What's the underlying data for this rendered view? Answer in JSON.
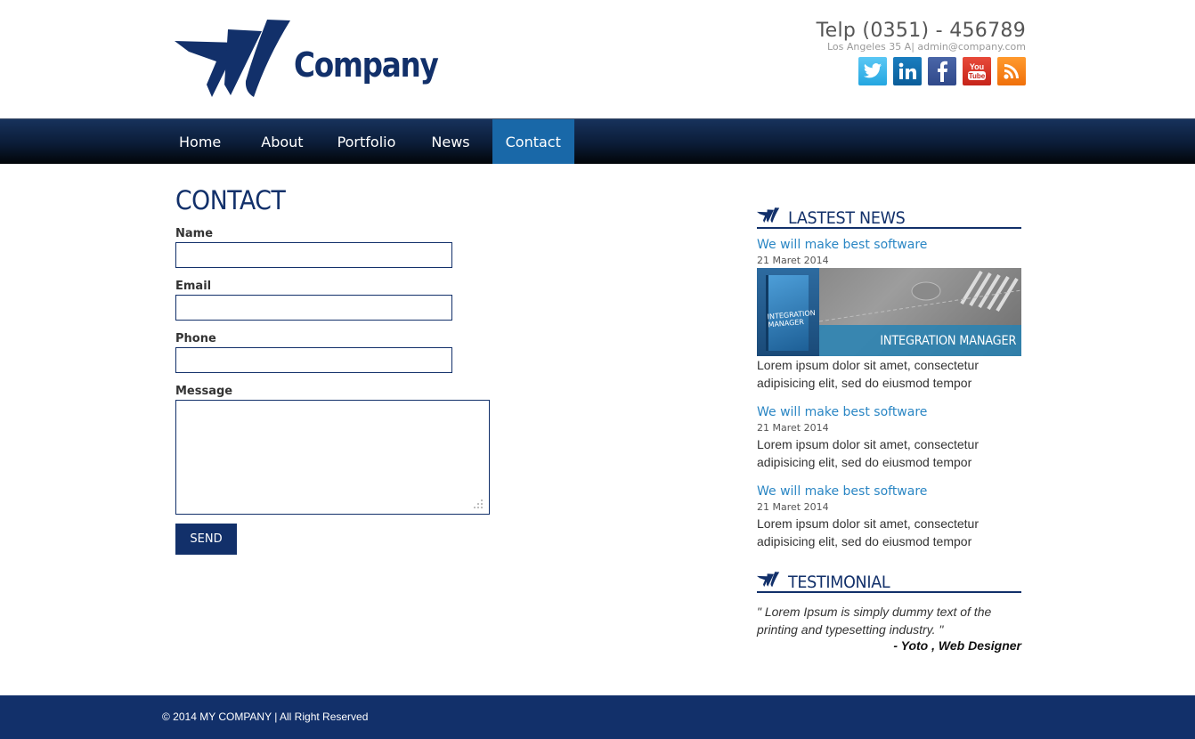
{
  "header": {
    "logo_text": "Company",
    "phone": "Telp (0351) - 456789",
    "address": "Los Angeles 35 A| admin@company.com",
    "social": [
      {
        "name": "twitter-icon",
        "label": "t"
      },
      {
        "name": "linkedin-icon",
        "label": "in"
      },
      {
        "name": "facebook-icon",
        "label": "f"
      },
      {
        "name": "youtube-icon",
        "label": "You Tube"
      },
      {
        "name": "rss-icon",
        "label": ""
      }
    ]
  },
  "nav": {
    "items": [
      "Home",
      "About",
      "Portfolio",
      "News",
      "Contact"
    ],
    "active": "Contact"
  },
  "contact": {
    "title": "CONTACT",
    "name_label": "Name",
    "email_label": "Email",
    "phone_label": "Phone",
    "message_label": "Message",
    "send_label": "SEND"
  },
  "sidebar": {
    "news_heading": "LASTEST NEWS",
    "news": [
      {
        "title": "We will make best software",
        "date": "21 Maret 2014",
        "body": "Lorem ipsum dolor sit amet, consectetur adipisicing elit, sed do eiusmod tempor",
        "image_caption": "INTEGRATION MANAGER",
        "image_box_text": "INTEGRATION MANAGER"
      },
      {
        "title": "We will make best software",
        "date": "21 Maret 2014",
        "body": "Lorem ipsum dolor sit amet, consectetur adipisicing elit, sed do eiusmod tempor"
      },
      {
        "title": "We will make best software",
        "date": "21 Maret 2014",
        "body": "Lorem ipsum dolor sit amet, consectetur adipisicing elit, sed do eiusmod tempor"
      }
    ],
    "testimonial_heading": "TESTIMONIAL",
    "testimonial_text": "\" Lorem Ipsum is simply dummy text of the printing and typesetting industry. \"",
    "testimonial_author": "- Yoto , Web Designer"
  },
  "footer": {
    "copyright": "© 2014 MY COMPANY | All Right Reserved"
  },
  "colors": {
    "brand": "#12306a",
    "accent": "#1968a8",
    "link": "#2a86c4"
  }
}
